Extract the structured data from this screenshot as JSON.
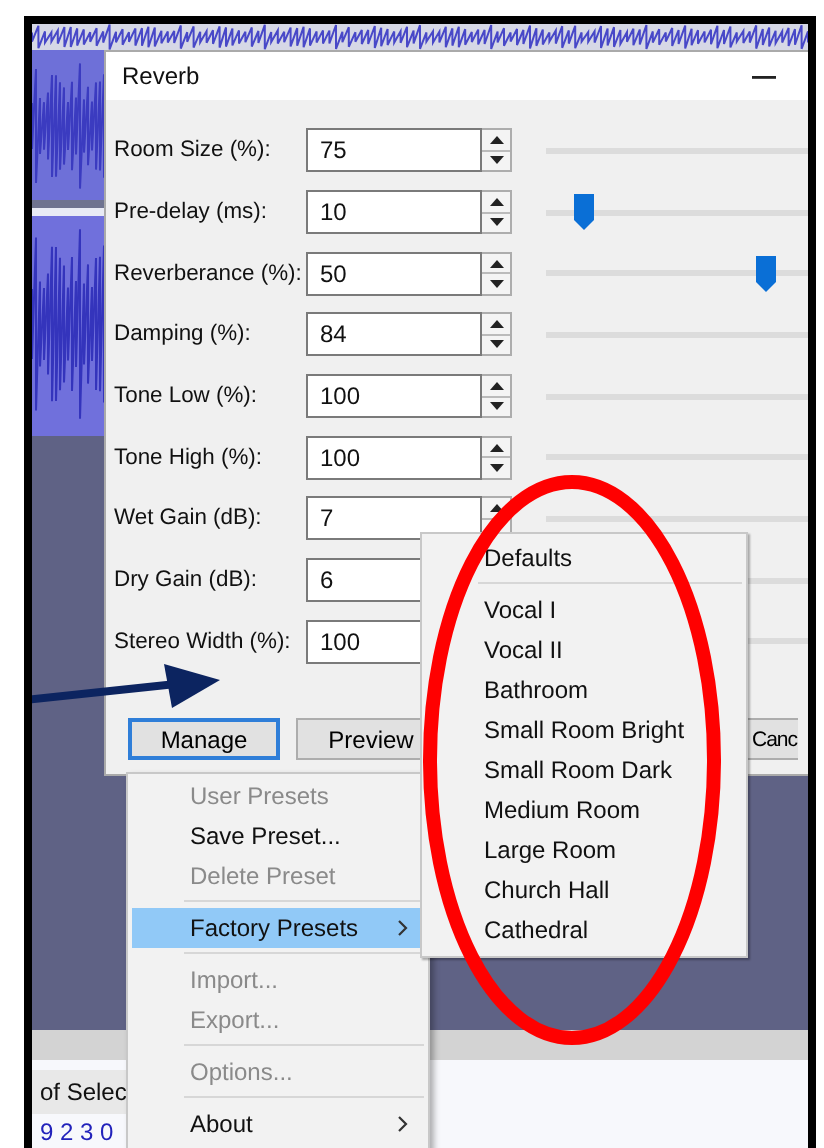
{
  "background": {
    "status_texts": [
      "of Selec",
      "9 2 3 0"
    ]
  },
  "dialog": {
    "title": "Reverb",
    "fields": [
      {
        "label": "Room Size (%):",
        "value": "75",
        "spinner": true
      },
      {
        "label": "Pre-delay (ms):",
        "value": "10",
        "level": 0.1,
        "spinner": true
      },
      {
        "label": "Reverberance (%):",
        "value": "50",
        "level": 0.76,
        "spinner": true
      },
      {
        "label": "Damping (%):",
        "value": "84",
        "spinner": true
      },
      {
        "label": "Tone Low (%):",
        "value": "100",
        "spinner": true
      },
      {
        "label": "Tone High (%):",
        "value": "100",
        "spinner": true
      },
      {
        "label": "Wet Gain (dB):",
        "value": "7",
        "spinner": true
      },
      {
        "label": "Dry Gain (dB):",
        "value": "6",
        "spinner": false
      },
      {
        "label": "Stereo Width (%):",
        "value": "100",
        "spinner": false
      }
    ],
    "buttons": [
      {
        "label": "Manage",
        "focused": true
      },
      {
        "label": "Preview",
        "focused": false
      },
      {
        "label": "Canc",
        "focused": false
      }
    ]
  },
  "manage_menu": {
    "items": [
      {
        "kind": "item",
        "label": "User Presets",
        "disabled": true,
        "selected": false,
        "submenu": false
      },
      {
        "kind": "item",
        "label": "Save Preset...",
        "disabled": false,
        "selected": false,
        "submenu": false
      },
      {
        "kind": "item",
        "label": "Delete Preset",
        "disabled": true,
        "selected": false,
        "submenu": false
      },
      {
        "kind": "separator"
      },
      {
        "kind": "item",
        "label": "Factory Presets",
        "disabled": false,
        "selected": true,
        "submenu": true
      },
      {
        "kind": "separator"
      },
      {
        "kind": "item",
        "label": "Import...",
        "disabled": true,
        "selected": false,
        "submenu": false
      },
      {
        "kind": "item",
        "label": "Export...",
        "disabled": true,
        "selected": false,
        "submenu": false
      },
      {
        "kind": "separator"
      },
      {
        "kind": "item",
        "label": "Options...",
        "disabled": true,
        "selected": false,
        "submenu": false
      },
      {
        "kind": "separator"
      },
      {
        "kind": "item",
        "label": "About",
        "disabled": false,
        "selected": false,
        "submenu": true
      }
    ]
  },
  "factory_presets_menu": {
    "items": [
      {
        "kind": "item",
        "label": "Defaults"
      },
      {
        "kind": "separator"
      },
      {
        "kind": "item",
        "label": "Vocal I"
      },
      {
        "kind": "item",
        "label": "Vocal II"
      },
      {
        "kind": "item",
        "label": "Bathroom"
      },
      {
        "kind": "item",
        "label": "Small Room Bright"
      },
      {
        "kind": "item",
        "label": "Small Room Dark"
      },
      {
        "kind": "item",
        "label": "Medium Room"
      },
      {
        "kind": "item",
        "label": "Large Room"
      },
      {
        "kind": "item",
        "label": "Church Hall"
      },
      {
        "kind": "item",
        "label": "Cathedral"
      }
    ]
  }
}
